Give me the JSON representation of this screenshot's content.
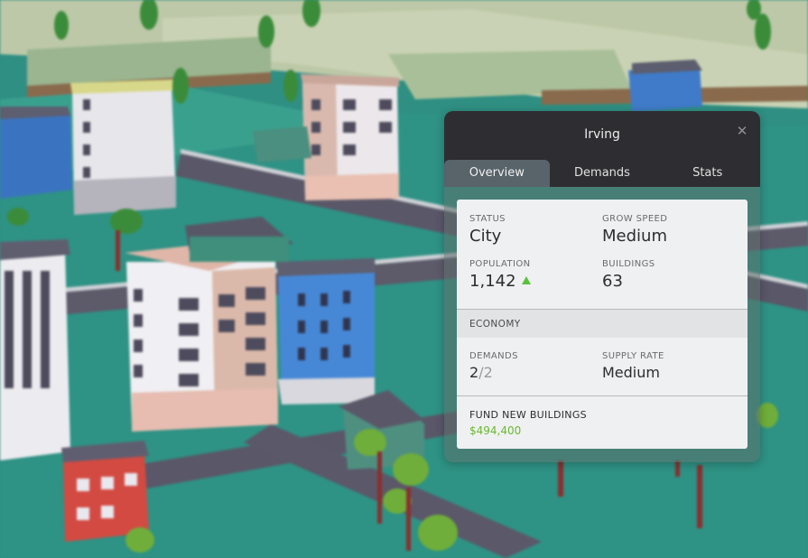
{
  "panel": {
    "title": "Irving",
    "close_icon": "close-icon",
    "tabs": [
      {
        "label": "Overview",
        "active": true
      },
      {
        "label": "Demands",
        "active": false
      },
      {
        "label": "Stats",
        "active": false
      }
    ]
  },
  "overview": {
    "status": {
      "label": "STATUS",
      "value": "City"
    },
    "grow_speed": {
      "label": "GROW SPEED",
      "value": "Medium"
    },
    "population": {
      "label": "POPULATION",
      "value": "1,142",
      "trend_icon": "up-triangle-icon"
    },
    "buildings": {
      "label": "BUILDINGS",
      "value": "63"
    },
    "economy": {
      "section_label": "ECONOMY",
      "demands": {
        "label": "DEMANDS",
        "met": "2",
        "total": "/2"
      },
      "supply_rate": {
        "label": "SUPPLY RATE",
        "value": "Medium"
      }
    },
    "fund": {
      "label": "FUND NEW BUILDINGS",
      "amount": "$494,400"
    }
  },
  "colors": {
    "accent_green": "#6ab830",
    "trend_green": "#59c23b",
    "panel_header": "#2e2e32",
    "card_bg": "#eff0f1"
  }
}
